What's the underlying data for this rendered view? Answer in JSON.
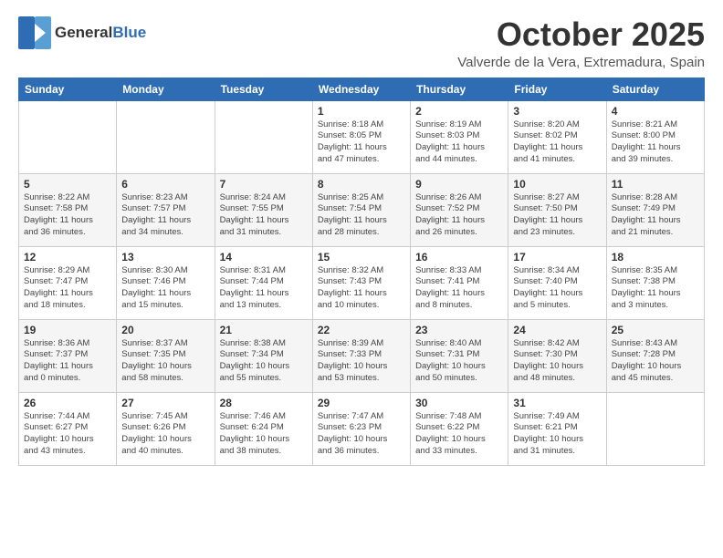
{
  "header": {
    "logo_general": "General",
    "logo_blue": "Blue",
    "month": "October 2025",
    "location": "Valverde de la Vera, Extremadura, Spain"
  },
  "weekdays": [
    "Sunday",
    "Monday",
    "Tuesday",
    "Wednesday",
    "Thursday",
    "Friday",
    "Saturday"
  ],
  "weeks": [
    [
      {
        "day": "",
        "info": ""
      },
      {
        "day": "",
        "info": ""
      },
      {
        "day": "",
        "info": ""
      },
      {
        "day": "1",
        "info": "Sunrise: 8:18 AM\nSunset: 8:05 PM\nDaylight: 11 hours\nand 47 minutes."
      },
      {
        "day": "2",
        "info": "Sunrise: 8:19 AM\nSunset: 8:03 PM\nDaylight: 11 hours\nand 44 minutes."
      },
      {
        "day": "3",
        "info": "Sunrise: 8:20 AM\nSunset: 8:02 PM\nDaylight: 11 hours\nand 41 minutes."
      },
      {
        "day": "4",
        "info": "Sunrise: 8:21 AM\nSunset: 8:00 PM\nDaylight: 11 hours\nand 39 minutes."
      }
    ],
    [
      {
        "day": "5",
        "info": "Sunrise: 8:22 AM\nSunset: 7:58 PM\nDaylight: 11 hours\nand 36 minutes."
      },
      {
        "day": "6",
        "info": "Sunrise: 8:23 AM\nSunset: 7:57 PM\nDaylight: 11 hours\nand 34 minutes."
      },
      {
        "day": "7",
        "info": "Sunrise: 8:24 AM\nSunset: 7:55 PM\nDaylight: 11 hours\nand 31 minutes."
      },
      {
        "day": "8",
        "info": "Sunrise: 8:25 AM\nSunset: 7:54 PM\nDaylight: 11 hours\nand 28 minutes."
      },
      {
        "day": "9",
        "info": "Sunrise: 8:26 AM\nSunset: 7:52 PM\nDaylight: 11 hours\nand 26 minutes."
      },
      {
        "day": "10",
        "info": "Sunrise: 8:27 AM\nSunset: 7:50 PM\nDaylight: 11 hours\nand 23 minutes."
      },
      {
        "day": "11",
        "info": "Sunrise: 8:28 AM\nSunset: 7:49 PM\nDaylight: 11 hours\nand 21 minutes."
      }
    ],
    [
      {
        "day": "12",
        "info": "Sunrise: 8:29 AM\nSunset: 7:47 PM\nDaylight: 11 hours\nand 18 minutes."
      },
      {
        "day": "13",
        "info": "Sunrise: 8:30 AM\nSunset: 7:46 PM\nDaylight: 11 hours\nand 15 minutes."
      },
      {
        "day": "14",
        "info": "Sunrise: 8:31 AM\nSunset: 7:44 PM\nDaylight: 11 hours\nand 13 minutes."
      },
      {
        "day": "15",
        "info": "Sunrise: 8:32 AM\nSunset: 7:43 PM\nDaylight: 11 hours\nand 10 minutes."
      },
      {
        "day": "16",
        "info": "Sunrise: 8:33 AM\nSunset: 7:41 PM\nDaylight: 11 hours\nand 8 minutes."
      },
      {
        "day": "17",
        "info": "Sunrise: 8:34 AM\nSunset: 7:40 PM\nDaylight: 11 hours\nand 5 minutes."
      },
      {
        "day": "18",
        "info": "Sunrise: 8:35 AM\nSunset: 7:38 PM\nDaylight: 11 hours\nand 3 minutes."
      }
    ],
    [
      {
        "day": "19",
        "info": "Sunrise: 8:36 AM\nSunset: 7:37 PM\nDaylight: 11 hours\nand 0 minutes."
      },
      {
        "day": "20",
        "info": "Sunrise: 8:37 AM\nSunset: 7:35 PM\nDaylight: 10 hours\nand 58 minutes."
      },
      {
        "day": "21",
        "info": "Sunrise: 8:38 AM\nSunset: 7:34 PM\nDaylight: 10 hours\nand 55 minutes."
      },
      {
        "day": "22",
        "info": "Sunrise: 8:39 AM\nSunset: 7:33 PM\nDaylight: 10 hours\nand 53 minutes."
      },
      {
        "day": "23",
        "info": "Sunrise: 8:40 AM\nSunset: 7:31 PM\nDaylight: 10 hours\nand 50 minutes."
      },
      {
        "day": "24",
        "info": "Sunrise: 8:42 AM\nSunset: 7:30 PM\nDaylight: 10 hours\nand 48 minutes."
      },
      {
        "day": "25",
        "info": "Sunrise: 8:43 AM\nSunset: 7:28 PM\nDaylight: 10 hours\nand 45 minutes."
      }
    ],
    [
      {
        "day": "26",
        "info": "Sunrise: 7:44 AM\nSunset: 6:27 PM\nDaylight: 10 hours\nand 43 minutes."
      },
      {
        "day": "27",
        "info": "Sunrise: 7:45 AM\nSunset: 6:26 PM\nDaylight: 10 hours\nand 40 minutes."
      },
      {
        "day": "28",
        "info": "Sunrise: 7:46 AM\nSunset: 6:24 PM\nDaylight: 10 hours\nand 38 minutes."
      },
      {
        "day": "29",
        "info": "Sunrise: 7:47 AM\nSunset: 6:23 PM\nDaylight: 10 hours\nand 36 minutes."
      },
      {
        "day": "30",
        "info": "Sunrise: 7:48 AM\nSunset: 6:22 PM\nDaylight: 10 hours\nand 33 minutes."
      },
      {
        "day": "31",
        "info": "Sunrise: 7:49 AM\nSunset: 6:21 PM\nDaylight: 10 hours\nand 31 minutes."
      },
      {
        "day": "",
        "info": ""
      }
    ]
  ]
}
